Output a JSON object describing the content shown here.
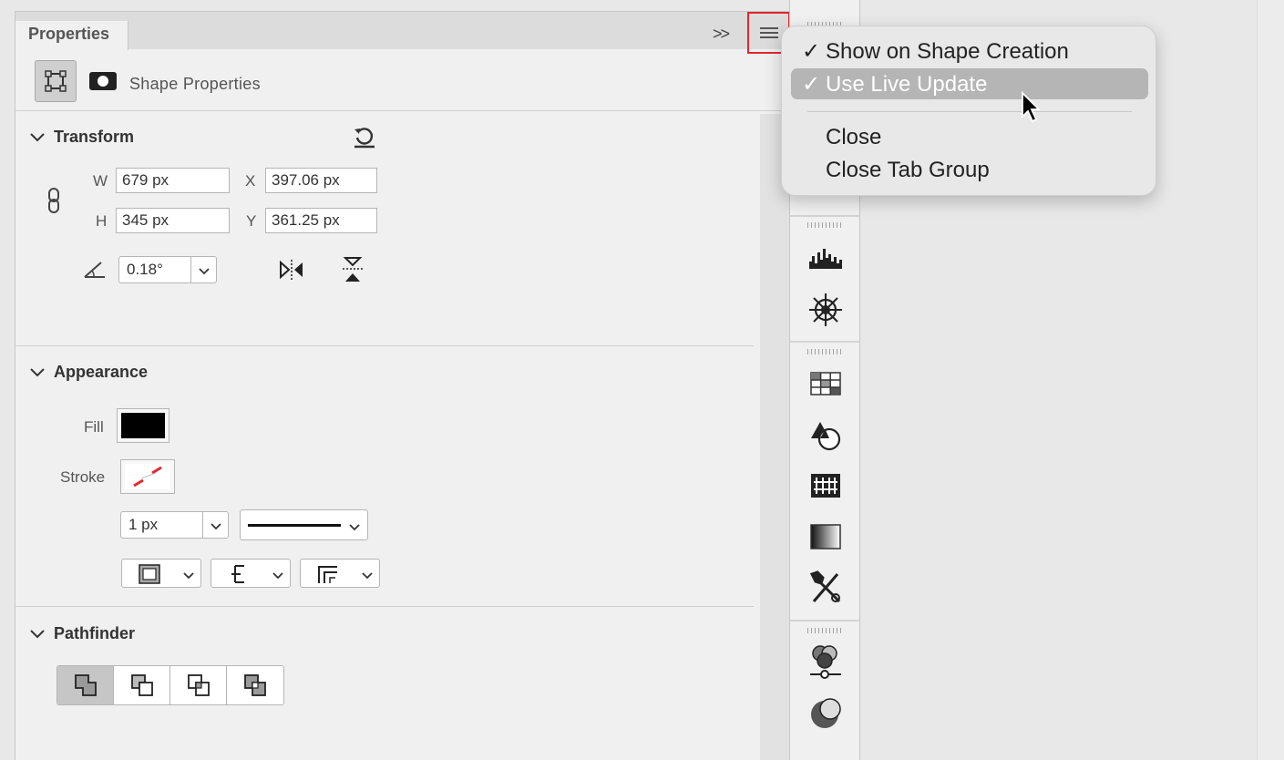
{
  "panel": {
    "tab_label": "Properties",
    "collapse_label": ">>",
    "shape_properties_label": "Shape Properties"
  },
  "transform": {
    "title": "Transform",
    "w_label": "W",
    "w_value": "679 px",
    "x_label": "X",
    "x_value": "397.06 px",
    "h_label": "H",
    "h_value": "345 px",
    "y_label": "Y",
    "y_value": "361.25 px",
    "angle_value": "0.18°"
  },
  "appearance": {
    "title": "Appearance",
    "fill_label": "Fill",
    "fill_color": "#000000",
    "stroke_label": "Stroke",
    "stroke_weight": "1 px"
  },
  "pathfinder": {
    "title": "Pathfinder"
  },
  "popup_menu": {
    "items": [
      {
        "label": "Show on Shape Creation",
        "checked": "✓"
      },
      {
        "label": "Use Live Update",
        "checked": "✓"
      },
      {
        "label": "Close"
      },
      {
        "label": "Close Tab Group"
      }
    ]
  },
  "colors": {
    "highlight_border": "#e0292e",
    "menu_highlight": "#b5b5b5"
  }
}
